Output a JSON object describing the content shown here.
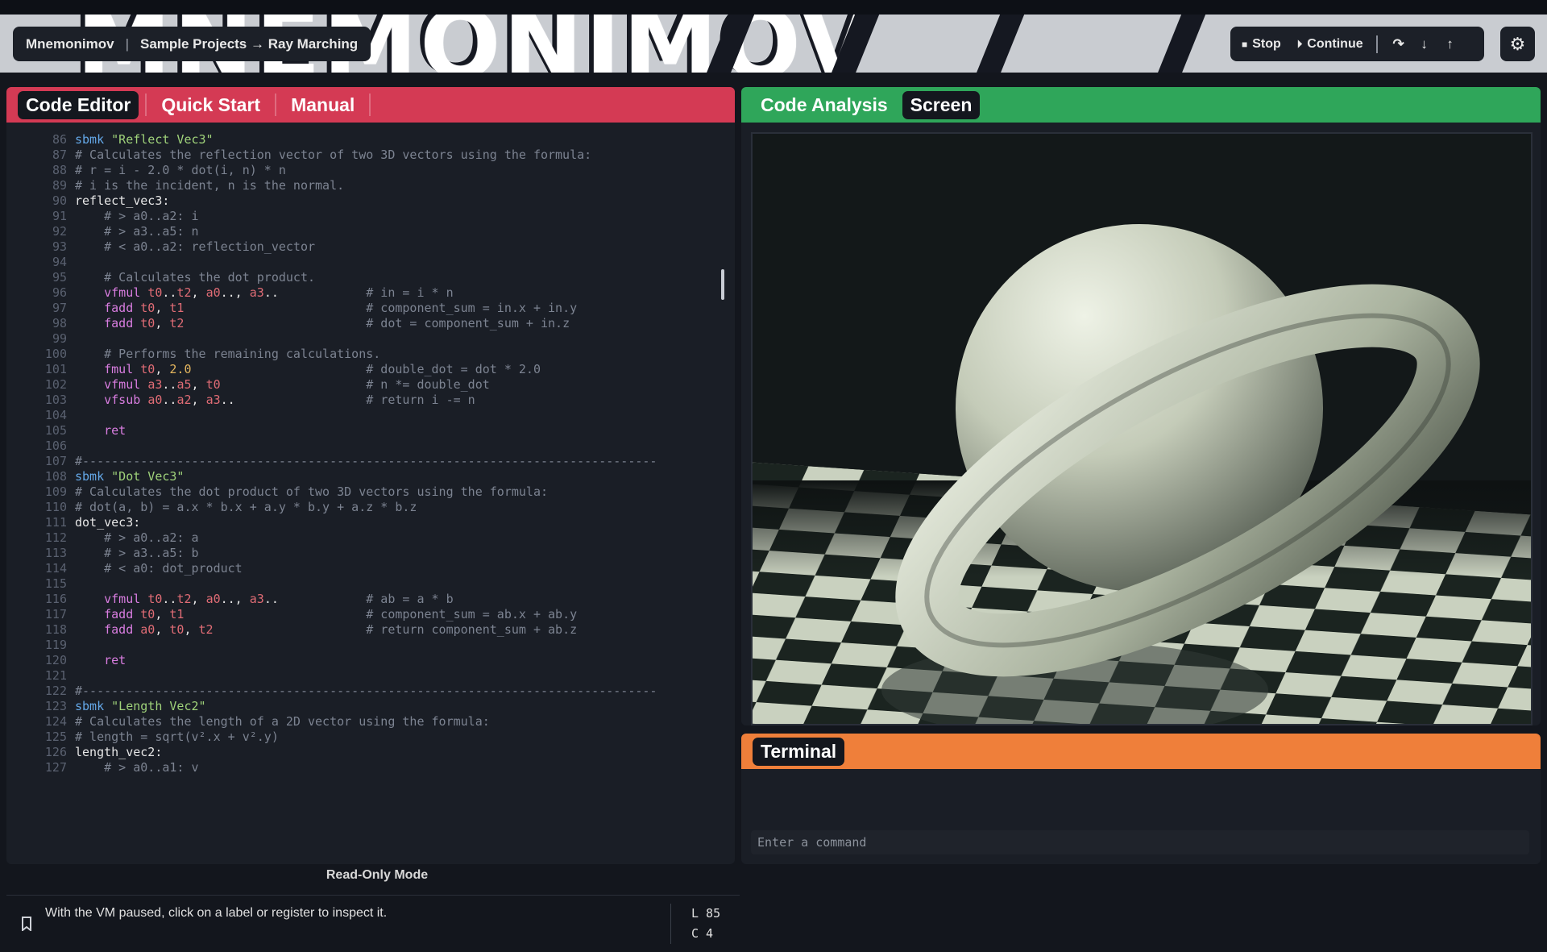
{
  "banner": {
    "text": "MNEMONIMOV"
  },
  "breadcrumb": {
    "app": "Mnemonimov",
    "sep": "|",
    "path": "Sample Projects → Ray Marching"
  },
  "controls": {
    "stop_label": "Stop",
    "continue_label": "Continue"
  },
  "icons": {
    "stop": "■",
    "continue": "⏵",
    "step_over": "↷",
    "step_into": "↓",
    "step_out": "↑",
    "settings": "⚙",
    "bookmark": "🔖"
  },
  "editor": {
    "tabs": [
      "Code Editor",
      "Quick Start",
      "Manual"
    ],
    "read_only_label": "Read-Only Mode",
    "hint": "With the VM paused, click on a label or register to inspect it.",
    "line_indicator": "L 85",
    "col_indicator": "C 4",
    "lines": [
      {
        "n": "86",
        "t": "sbmk \"Reflect Vec3\""
      },
      {
        "n": "87",
        "t": "# Calculates the reflection vector of two 3D vectors using the formula:"
      },
      {
        "n": "88",
        "t": "# r = i - 2.0 * dot(i, n) * n"
      },
      {
        "n": "89",
        "t": "# i is the incident, n is the normal."
      },
      {
        "n": "90",
        "t": "reflect_vec3:"
      },
      {
        "n": "91",
        "t": "    # > a0..a2: i"
      },
      {
        "n": "92",
        "t": "    # > a3..a5: n"
      },
      {
        "n": "93",
        "t": "    # < a0..a2: reflection_vector"
      },
      {
        "n": "94",
        "t": ""
      },
      {
        "n": "95",
        "t": "    # Calculates the dot product."
      },
      {
        "n": "96",
        "t": "    vfmul t0..t2, a0.., a3..            # in = i * n"
      },
      {
        "n": "97",
        "t": "    fadd t0, t1                         # component_sum = in.x + in.y"
      },
      {
        "n": "98",
        "t": "    fadd t0, t2                         # dot = component_sum + in.z"
      },
      {
        "n": "99",
        "t": ""
      },
      {
        "n": "100",
        "t": "    # Performs the remaining calculations."
      },
      {
        "n": "101",
        "t": "    fmul t0, 2.0                        # double_dot = dot * 2.0"
      },
      {
        "n": "102",
        "t": "    vfmul a3..a5, t0                    # n *= double_dot"
      },
      {
        "n": "103",
        "t": "    vfsub a0..a2, a3..                  # return i -= n"
      },
      {
        "n": "104",
        "t": ""
      },
      {
        "n": "105",
        "t": "    ret"
      },
      {
        "n": "106",
        "t": ""
      },
      {
        "n": "107",
        "t": "#-------------------------------------------------------------------------------"
      },
      {
        "n": "108",
        "t": "sbmk \"Dot Vec3\""
      },
      {
        "n": "109",
        "t": "# Calculates the dot product of two 3D vectors using the formula:"
      },
      {
        "n": "110",
        "t": "# dot(a, b) = a.x * b.x + a.y * b.y + a.z * b.z"
      },
      {
        "n": "111",
        "t": "dot_vec3:"
      },
      {
        "n": "112",
        "t": "    # > a0..a2: a"
      },
      {
        "n": "113",
        "t": "    # > a3..a5: b"
      },
      {
        "n": "114",
        "t": "    # < a0: dot_product"
      },
      {
        "n": "115",
        "t": ""
      },
      {
        "n": "116",
        "t": "    vfmul t0..t2, a0.., a3..            # ab = a * b"
      },
      {
        "n": "117",
        "t": "    fadd t0, t1                         # component_sum = ab.x + ab.y"
      },
      {
        "n": "118",
        "t": "    fadd a0, t0, t2                     # return component_sum + ab.z"
      },
      {
        "n": "119",
        "t": ""
      },
      {
        "n": "120",
        "t": "    ret"
      },
      {
        "n": "121",
        "t": ""
      },
      {
        "n": "122",
        "t": "#-------------------------------------------------------------------------------"
      },
      {
        "n": "123",
        "t": "sbmk \"Length Vec2\""
      },
      {
        "n": "124",
        "t": "# Calculates the length of a 2D vector using the formula:"
      },
      {
        "n": "125",
        "t": "# length = sqrt(v².x + v².y)"
      },
      {
        "n": "126",
        "t": "length_vec2:"
      },
      {
        "n": "127",
        "t": "    # > a0..a1: v"
      }
    ]
  },
  "analysis": {
    "tabs": [
      "Code Analysis",
      "Screen"
    ]
  },
  "terminal": {
    "title": "Terminal",
    "placeholder": "Enter a command"
  },
  "colors": {
    "editor_tab": "#d43a54",
    "analysis_tab": "#2fa65a",
    "terminal_tab": "#ef7f3a",
    "render_tint": "#d6dccd"
  }
}
